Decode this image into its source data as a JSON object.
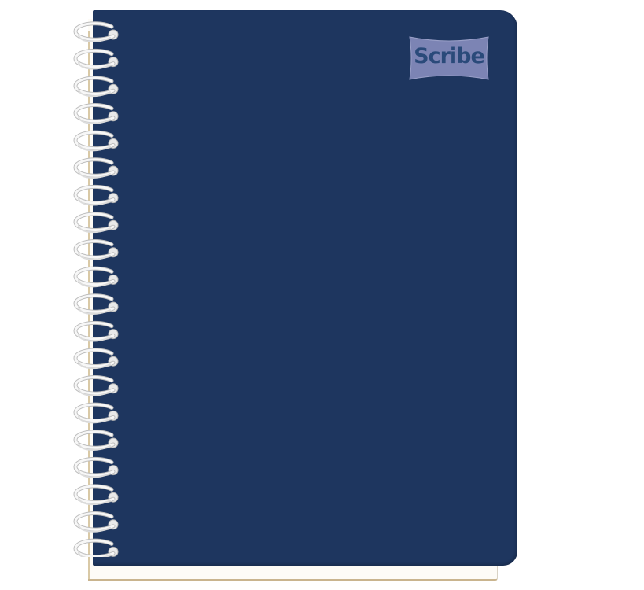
{
  "product": {
    "brand_text": "Scribe",
    "colors": {
      "cover": "#1e365f",
      "logo_badge": "#7c84b4",
      "logo_text": "#2a4a7a",
      "spiral": "#f2f2f2",
      "page_edge": "#c9b48e"
    },
    "spiral_ring_count": 20
  }
}
